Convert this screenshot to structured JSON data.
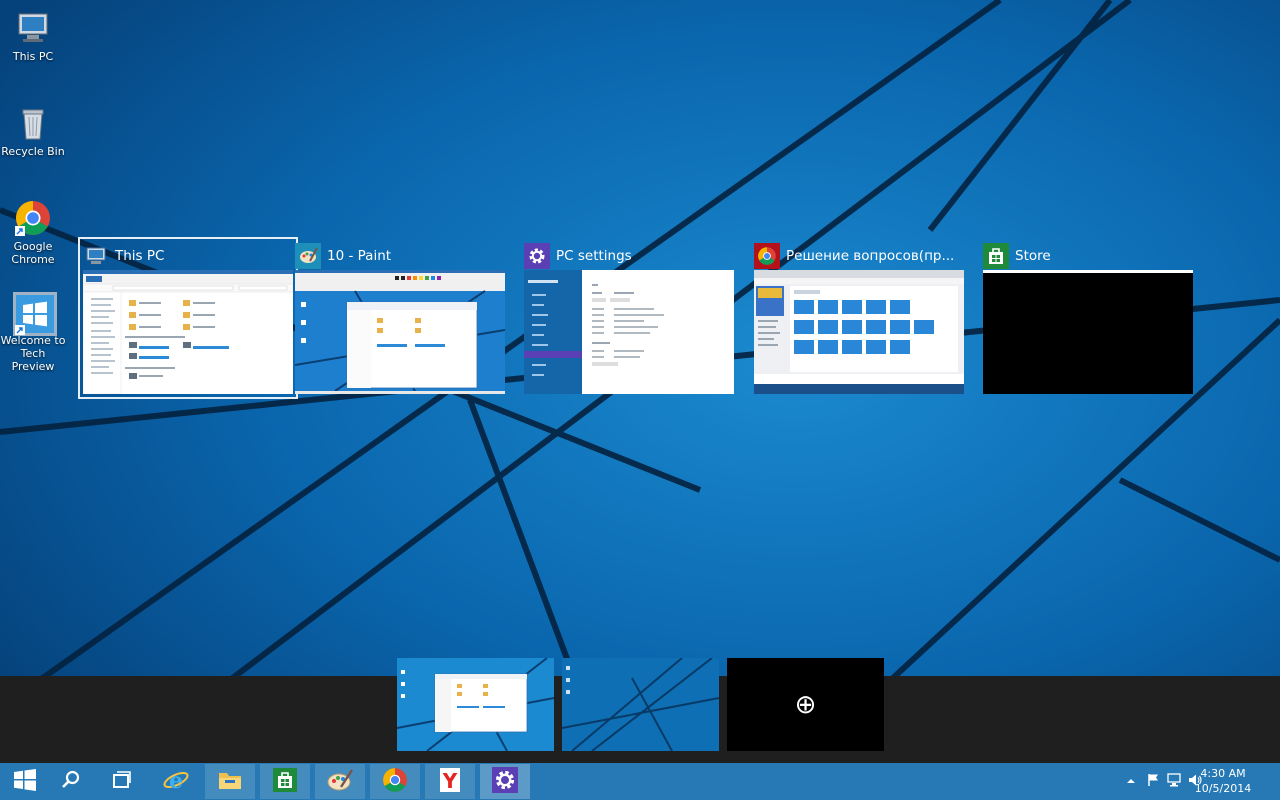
{
  "desktop_icons": [
    {
      "label": "This PC",
      "icon": "this-pc-icon"
    },
    {
      "label": "Recycle Bin",
      "icon": "recycle-bin-icon"
    },
    {
      "label": "Google Chrome",
      "icon": "chrome-icon"
    },
    {
      "label": "Welcome to Tech Preview",
      "icon": "windows-logo-icon"
    }
  ],
  "task_view": {
    "windows": [
      {
        "title": "This PC",
        "icon": "this-pc-icon",
        "selected": true
      },
      {
        "title": "10 - Paint",
        "icon": "paint-icon",
        "selected": false
      },
      {
        "title": "PC settings",
        "icon": "gear-icon",
        "selected": false
      },
      {
        "title": "Решение вопросов(пр...",
        "icon": "chrome-icon",
        "selected": false
      },
      {
        "title": "Store",
        "icon": "store-icon",
        "selected": false
      }
    ]
  },
  "virtual_desktops": {
    "desktops": [
      "desktop-1",
      "desktop-2"
    ],
    "add_label": "⊕"
  },
  "taskbar": {
    "items": [
      "start-icon",
      "search-icon",
      "task-view-icon",
      "internet-explorer-icon",
      "file-explorer-icon",
      "store-icon",
      "paint-icon",
      "chrome-icon",
      "yandex-icon",
      "gear-icon"
    ],
    "active_index": 9
  },
  "tray": {
    "time": "4:30 AM",
    "date": "10/5/2014"
  },
  "colors": {
    "taskbar": "#2679b4",
    "accent": "#0a5fa3",
    "vdbar": "#1f1f1f"
  }
}
